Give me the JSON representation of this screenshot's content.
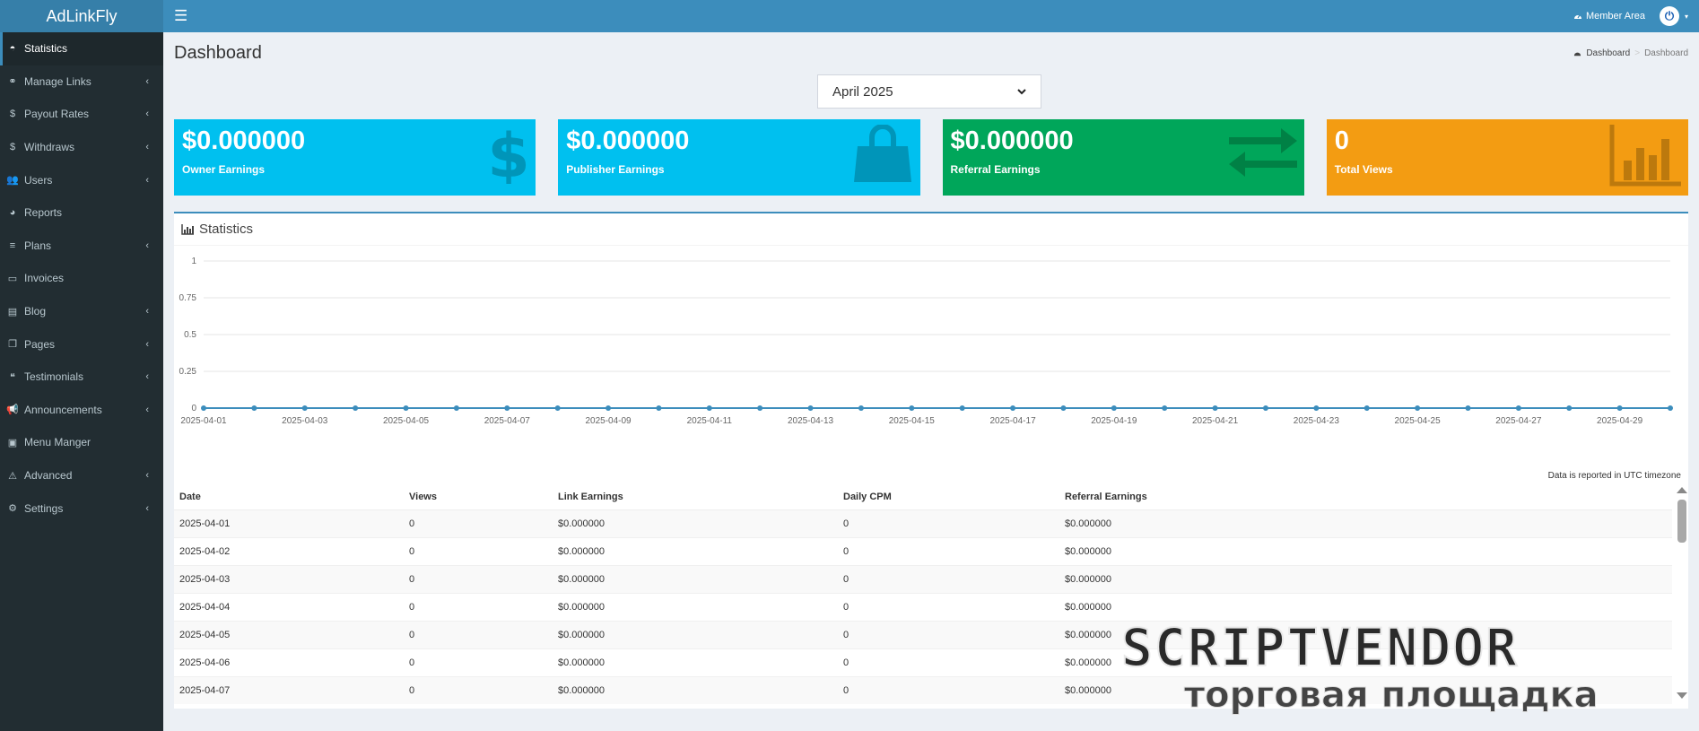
{
  "app": {
    "logo": "AdLinkFly"
  },
  "header": {
    "toggle_icon": "☰",
    "member_area": "Member Area"
  },
  "sidebar": {
    "items": [
      {
        "label": "Statistics",
        "icon": "dashboard-icon",
        "glyph": "◓",
        "active": true,
        "arrow": false
      },
      {
        "label": "Manage Links",
        "icon": "link-icon",
        "glyph": "⚭",
        "active": false,
        "arrow": true
      },
      {
        "label": "Payout Rates",
        "icon": "dollar-icon",
        "glyph": "$",
        "active": false,
        "arrow": true
      },
      {
        "label": "Withdraws",
        "icon": "dollar-icon",
        "glyph": "$",
        "active": false,
        "arrow": true
      },
      {
        "label": "Users",
        "icon": "users-icon",
        "glyph": "👥",
        "active": false,
        "arrow": true
      },
      {
        "label": "Reports",
        "icon": "pie-chart-icon",
        "glyph": "◕",
        "active": false,
        "arrow": false
      },
      {
        "label": "Plans",
        "icon": "list-icon",
        "glyph": "≡",
        "active": false,
        "arrow": true
      },
      {
        "label": "Invoices",
        "icon": "credit-card-icon",
        "glyph": "▭",
        "active": false,
        "arrow": false
      },
      {
        "label": "Blog",
        "icon": "file-icon",
        "glyph": "▤",
        "active": false,
        "arrow": true
      },
      {
        "label": "Pages",
        "icon": "copy-icon",
        "glyph": "❐",
        "active": false,
        "arrow": true
      },
      {
        "label": "Testimonials",
        "icon": "quote-icon",
        "glyph": "❝",
        "active": false,
        "arrow": true
      },
      {
        "label": "Announcements",
        "icon": "bullhorn-icon",
        "glyph": "📢",
        "active": false,
        "arrow": true
      },
      {
        "label": "Menu Manger",
        "icon": "caret-square-icon",
        "glyph": "▣",
        "active": false,
        "arrow": false
      },
      {
        "label": "Advanced",
        "icon": "warning-icon",
        "glyph": "⚠",
        "active": false,
        "arrow": true
      },
      {
        "label": "Settings",
        "icon": "cogs-icon",
        "glyph": "⚙",
        "active": false,
        "arrow": true
      }
    ],
    "arrow_glyph": "‹"
  },
  "page": {
    "title": "Dashboard",
    "breadcrumb": {
      "home": "Dashboard",
      "separator": ">",
      "current": "Dashboard"
    },
    "month_select": {
      "value": "April 2025"
    }
  },
  "info_boxes": [
    {
      "value": "$0.000000",
      "label": "Owner Earnings",
      "color": "#00c0ef",
      "icon": "dollar-icon"
    },
    {
      "value": "$0.000000",
      "label": "Publisher Earnings",
      "color": "#00c0ef",
      "icon": "shopping-bag-icon"
    },
    {
      "value": "$0.000000",
      "label": "Referral Earnings",
      "color": "#00a65a",
      "icon": "exchange-icon"
    },
    {
      "value": "0",
      "label": "Total Views",
      "color": "#f39c12",
      "icon": "bar-chart-icon"
    }
  ],
  "statistics": {
    "title": "Statistics",
    "utc_note": "Data is reported in UTC timezone",
    "columns": [
      "Date",
      "Views",
      "Link Earnings",
      "Daily CPM",
      "Referral Earnings"
    ],
    "rows": [
      [
        "2025-04-01",
        "0",
        "$0.000000",
        "0",
        "$0.000000"
      ],
      [
        "2025-04-02",
        "0",
        "$0.000000",
        "0",
        "$0.000000"
      ],
      [
        "2025-04-03",
        "0",
        "$0.000000",
        "0",
        "$0.000000"
      ],
      [
        "2025-04-04",
        "0",
        "$0.000000",
        "0",
        "$0.000000"
      ],
      [
        "2025-04-05",
        "0",
        "$0.000000",
        "0",
        "$0.000000"
      ],
      [
        "2025-04-06",
        "0",
        "$0.000000",
        "0",
        "$0.000000"
      ],
      [
        "2025-04-07",
        "0",
        "$0.000000",
        "0",
        "$0.000000"
      ]
    ]
  },
  "chart_data": {
    "type": "line",
    "title": "",
    "xlabel": "",
    "ylabel": "",
    "ylim": [
      0,
      1
    ],
    "yticks": [
      "0",
      "0.25",
      "0.5",
      "0.75",
      "1"
    ],
    "x": [
      "2025-04-01",
      "2025-04-02",
      "2025-04-03",
      "2025-04-04",
      "2025-04-05",
      "2025-04-06",
      "2025-04-07",
      "2025-04-08",
      "2025-04-09",
      "2025-04-10",
      "2025-04-11",
      "2025-04-12",
      "2025-04-13",
      "2025-04-14",
      "2025-04-15",
      "2025-04-16",
      "2025-04-17",
      "2025-04-18",
      "2025-04-19",
      "2025-04-20",
      "2025-04-21",
      "2025-04-22",
      "2025-04-23",
      "2025-04-24",
      "2025-04-25",
      "2025-04-26",
      "2025-04-27",
      "2025-04-28",
      "2025-04-29",
      "2025-04-30"
    ],
    "xtick_labels": [
      "2025-04-01",
      "2025-04-03",
      "2025-04-05",
      "2025-04-07",
      "2025-04-09",
      "2025-04-11",
      "2025-04-13",
      "2025-04-15",
      "2025-04-17",
      "2025-04-19",
      "2025-04-21",
      "2025-04-23",
      "2025-04-25",
      "2025-04-27",
      "2025-04-29"
    ],
    "series": [
      {
        "values": [
          0,
          0,
          0,
          0,
          0,
          0,
          0,
          0,
          0,
          0,
          0,
          0,
          0,
          0,
          0,
          0,
          0,
          0,
          0,
          0,
          0,
          0,
          0,
          0,
          0,
          0,
          0,
          0,
          0,
          0
        ],
        "color": "#3c8dbc"
      }
    ],
    "grid": true
  },
  "watermark": {
    "line1": "SCRIPTVENDOR",
    "line2": "торговая площадка"
  }
}
